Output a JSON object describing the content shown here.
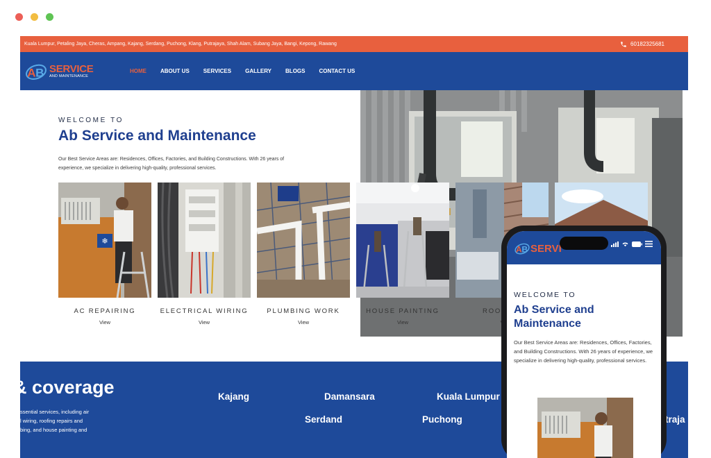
{
  "window": {
    "dots": [
      {
        "name": "close-dot",
        "color": "#ec5f57"
      },
      {
        "name": "minimize-dot",
        "color": "#f2bd42"
      },
      {
        "name": "zoom-dot",
        "color": "#5fc454"
      }
    ]
  },
  "colors": {
    "accent_orange": "#e8603e",
    "brand_blue": "#1e4a9a",
    "heading_blue": "#1f3f8f"
  },
  "topbar": {
    "areas": "Kuala Lumpur, Petaling Jaya, Cheras, Ampang, Kajang, Serdang, Puchong, Klang, Putrajaya, Shah Alam, Subang Jaya, Bangi, Kepong, Rawang",
    "phone": "60182325681",
    "phone_icon": "phone-icon"
  },
  "logo": {
    "mark": "AB",
    "name": "SERVICE",
    "tagline": "AND MAINTENANCE"
  },
  "nav": {
    "items": [
      {
        "label": "HOME",
        "active": true
      },
      {
        "label": "ABOUT US",
        "active": false
      },
      {
        "label": "SERVICES",
        "active": false
      },
      {
        "label": "GALLERY",
        "active": false
      },
      {
        "label": "BLOGS",
        "active": false
      },
      {
        "label": "CONTACT US",
        "active": false
      }
    ]
  },
  "hero": {
    "welcome": "WELCOME TO",
    "title": "Ab Service and Maintenance",
    "description": "Our Best Service Areas are: Residences, Offices, Factories, and Building Constructions. With 26 years of experience, we specialize in delivering high-quality, professional services."
  },
  "services": [
    {
      "name": "AC REPAIRING",
      "link": "View"
    },
    {
      "name": "ELECTRICAL WIRING",
      "link": "View"
    },
    {
      "name": "PLUMBING WORK",
      "link": "View"
    },
    {
      "name": "HOUSE PAINTING",
      "link": "View"
    },
    {
      "name": "ROOF RE",
      "link": "V"
    }
  ],
  "coverage": {
    "heading": "& coverage",
    "text_lines": [
      "ssential services, including air",
      "l wiring, roofing repairs and",
      "bing, and house painting and"
    ],
    "cities": [
      "Kajang",
      "Damansara",
      "Kuala Lumpur",
      "Serdand",
      "Puchong",
      "traja"
    ]
  },
  "mobile": {
    "logo_name": "SERVI",
    "welcome": "WELCOME TO",
    "title": "Ab Service and Maintenance",
    "description": "Our Best Service Areas are: Residences, Offices, Factories, and Building Constructions. With 26 years of experience, we specialize in delivering high-quality, professional services."
  }
}
